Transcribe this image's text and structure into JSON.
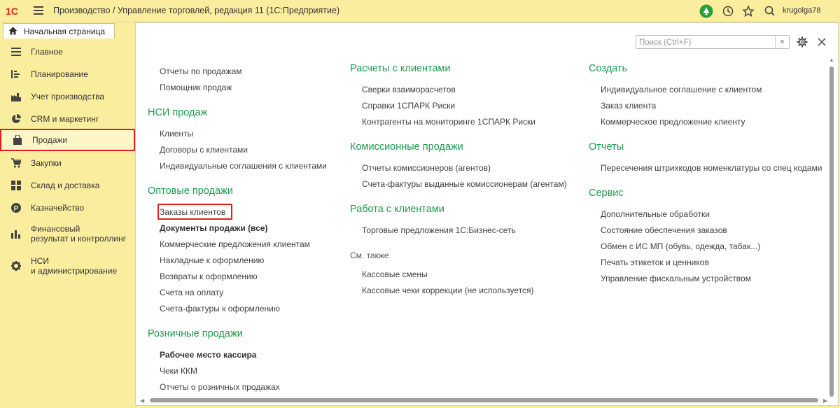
{
  "titlebar": {
    "logo": "1С",
    "title": "Производство / Управление торговлей, редакция 11  (1С:Предприятие)",
    "user": "krugolga78",
    "icons": [
      "bell-icon",
      "history-icon",
      "star-icon",
      "search-icon"
    ]
  },
  "home_tab": {
    "label": "Начальная страница",
    "icon": "home-icon"
  },
  "sidebar": {
    "items": [
      {
        "label": "Главное",
        "icon": "list-icon"
      },
      {
        "label": "Планирование",
        "icon": "plan-icon"
      },
      {
        "label": "Учет производства",
        "icon": "factory-icon"
      },
      {
        "label": "CRM и маркетинг",
        "icon": "pie-icon"
      },
      {
        "label": "Продажи",
        "icon": "bag-icon",
        "active": true
      },
      {
        "label": "Закупки",
        "icon": "cart-icon"
      },
      {
        "label": "Склад и доставка",
        "icon": "grid-icon"
      },
      {
        "label": "Казначейство",
        "icon": "coin-icon"
      },
      {
        "label": "Финансовый",
        "label2": "результат и контроллинг",
        "icon": "bars-icon"
      },
      {
        "label": "НСИ",
        "label2": "и администрирование",
        "icon": "gear-icon"
      }
    ]
  },
  "search": {
    "placeholder": "Поиск (Ctrl+F)",
    "value": "",
    "clear": "×"
  },
  "col1": {
    "top_links": [
      "Отчеты по продажам",
      "Помощник продаж"
    ],
    "nsi_title": "НСИ продаж",
    "nsi_links": [
      "Клиенты",
      "Договоры с клиентами",
      "Индивидуальные соглашения с клиентами"
    ],
    "wholesale_title": "Оптовые продажи",
    "wholesale_links": [
      "Заказы клиентов",
      "Документы продажи (все)",
      "Коммерческие предложения клиентам",
      "Накладные к оформлению",
      "Возвраты к оформлению",
      "Счета на оплату",
      "Счета-фактуры к оформлению"
    ],
    "retail_title": "Розничные продажи",
    "retail_links": [
      "Рабочее место кассира",
      "Чеки ККМ",
      "Отчеты о розничных продажах"
    ]
  },
  "col2": {
    "settlements_title": "Расчеты с клиентами",
    "settlements_links": [
      "Сверки взаиморасчетов",
      "Справки 1СПАРК Риски",
      "Контрагенты на мониторинге 1СПАРК Риски"
    ],
    "commission_title": "Комиссионные продажи",
    "commission_links": [
      "Отчеты комиссионеров (агентов)",
      "Счета-фактуры выданные комиссионерам (агентам)"
    ],
    "clients_title": "Работа с клиентами",
    "clients_links": [
      "Торговые предложения 1С:Бизнес-сеть"
    ],
    "see_also": "См. также",
    "see_also_links": [
      "Кассовые смены",
      "Кассовые чеки коррекции (не используется)"
    ]
  },
  "col3": {
    "create_title": "Создать",
    "create_links": [
      "Индивидуальное соглашение с клиентом",
      "Заказ клиента",
      "Коммерческое предложение клиенту"
    ],
    "reports_title": "Отчеты",
    "reports_links": [
      "Пересечения штрихкодов номенклатуры со спец кодами"
    ],
    "service_title": "Сервис",
    "service_links": [
      "Дополнительные обработки",
      "Состояние обеспечения заказов",
      "Обмен с ИС МП (обувь, одежда, табак...)",
      "Печать этикеток и ценников",
      "Управление фискальным устройством"
    ]
  },
  "colors": {
    "section": "#1f9a4f",
    "panel": "#fbed9e",
    "highlight": "#e01f1f"
  }
}
